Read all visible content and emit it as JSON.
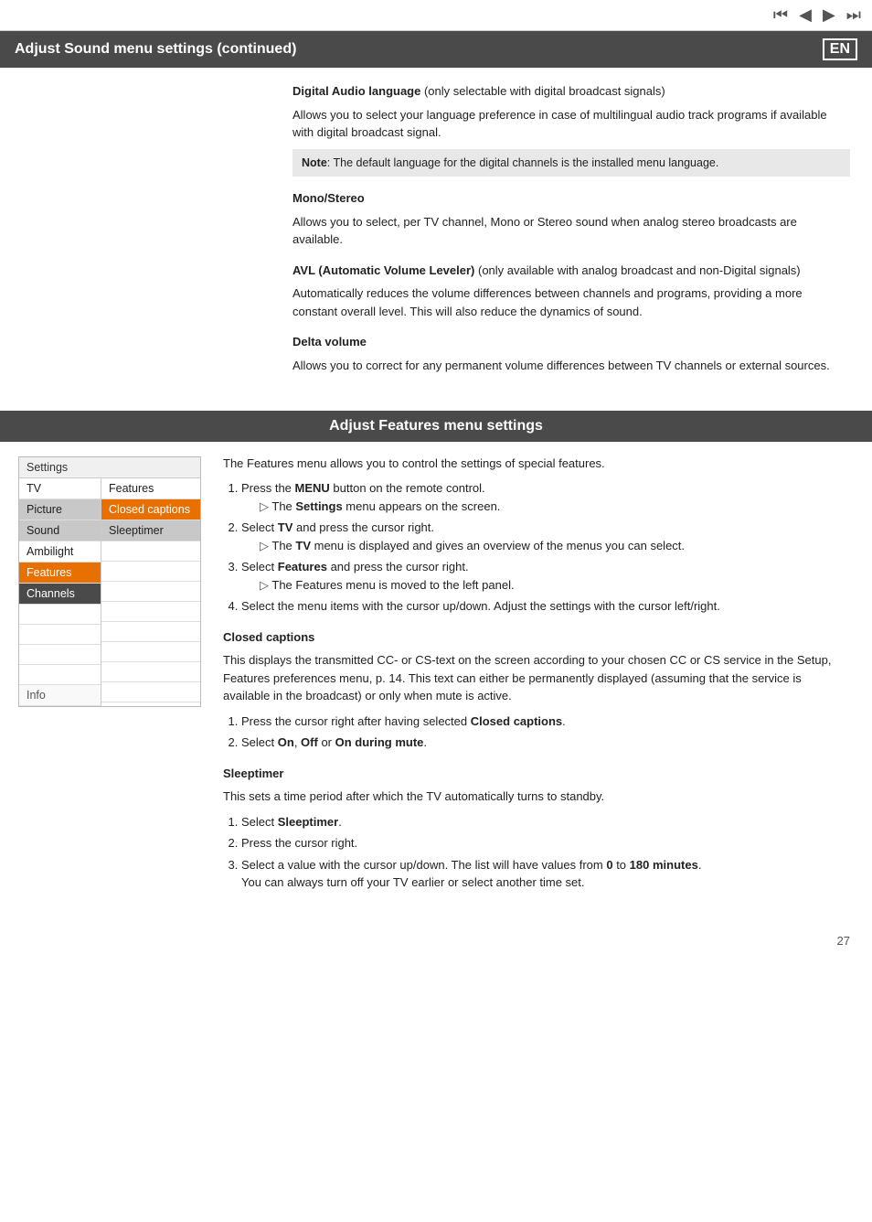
{
  "nav": {
    "icons": [
      "⏮",
      "◀",
      "▶",
      "⏭"
    ]
  },
  "upper_section": {
    "title": "Adjust Sound menu settings  (continued)",
    "en_badge": "EN",
    "digital_audio": {
      "heading": "Digital Audio language",
      "heading_suffix": " (only selectable with digital broadcast signals)",
      "para1": "Allows you to select your language preference in case of multilingual audio track programs if available with digital broadcast signal.",
      "note_label": "Note",
      "note_text": ": The default language for the digital channels is the installed menu language."
    },
    "mono_stereo": {
      "heading": "Mono/Stereo",
      "para1": "Allows you to select, per TV channel, Mono or Stereo sound when analog stereo broadcasts are available."
    },
    "avl": {
      "heading": "AVL (Automatic Volume Leveler)",
      "heading_suffix": " (only available with analog broadcast and non-Digital signals)",
      "para1": "Automatically reduces the volume differences between channels and programs, providing a more constant overall level. This will also reduce the dynamics of sound."
    },
    "delta_volume": {
      "heading": "Delta volume",
      "para1": "Allows you to correct for any permanent volume differences between TV channels or external sources."
    }
  },
  "features_section": {
    "title": "Adjust Features menu settings",
    "intro": "The Features menu allows you to control the settings of special features.",
    "steps": [
      {
        "number": "1.",
        "text": "Press the ",
        "bold": "MENU",
        "rest": " button on the remote control.",
        "sub": "The Settings menu appears on the screen."
      },
      {
        "number": "2.",
        "text": "Select ",
        "bold": "TV",
        "rest": " and press the cursor right.",
        "sub": "The TV menu is displayed and gives an overview of the menus you can select."
      },
      {
        "number": "3.",
        "text": "Select ",
        "bold": "Features",
        "rest": " and press the cursor right.",
        "sub": "The Features menu is moved to the left panel."
      },
      {
        "number": "4.",
        "text": "Select the menu items with the cursor up/down. Adjust the settings with the cursor left/right.",
        "bold": "",
        "rest": "",
        "sub": ""
      }
    ],
    "closed_captions": {
      "heading": "Closed captions",
      "para1": "This displays the transmitted CC- or CS-text on the screen according to your chosen CC or CS service in the Setup, Features preferences menu, p. 14. This text can either be permanently displayed (assuming that the service is available in the broadcast) or only when mute is active.",
      "steps": [
        {
          "number": "1.",
          "text": "Press the cursor right after having selected ",
          "bold": "Closed captions",
          "rest": "."
        },
        {
          "number": "2.",
          "text": "Select ",
          "bold": "On",
          "rest": ", ",
          "bold2": "Off",
          "rest2": " or ",
          "bold3": "On during mute",
          "rest3": "."
        }
      ]
    },
    "sleeptimer": {
      "heading": "Sleeptimer",
      "para1": "This sets a time period after which the TV automatically turns to standby.",
      "steps": [
        {
          "number": "1.",
          "text": "Select ",
          "bold": "Sleeptimer",
          "rest": "."
        },
        {
          "number": "2.",
          "text": "Press the cursor right.",
          "bold": "",
          "rest": ""
        },
        {
          "number": "3.",
          "text": "Select a value with the cursor up/down. The list will have values from ",
          "bold": "0",
          "rest": " to ",
          "bold2": "180 minutes",
          "rest2": ".",
          "extra": "You can always turn off your TV earlier or select another time set."
        }
      ]
    }
  },
  "sidebar": {
    "title": "Settings",
    "items_left": [
      "TV",
      "Picture",
      "Sound",
      "Ambilight",
      "Features",
      "Channels",
      "",
      "",
      "",
      "",
      "Info"
    ],
    "items_right": [
      "Features",
      "Closed captions",
      "Sleeptimer",
      "",
      "",
      ""
    ]
  },
  "page_number": "27"
}
